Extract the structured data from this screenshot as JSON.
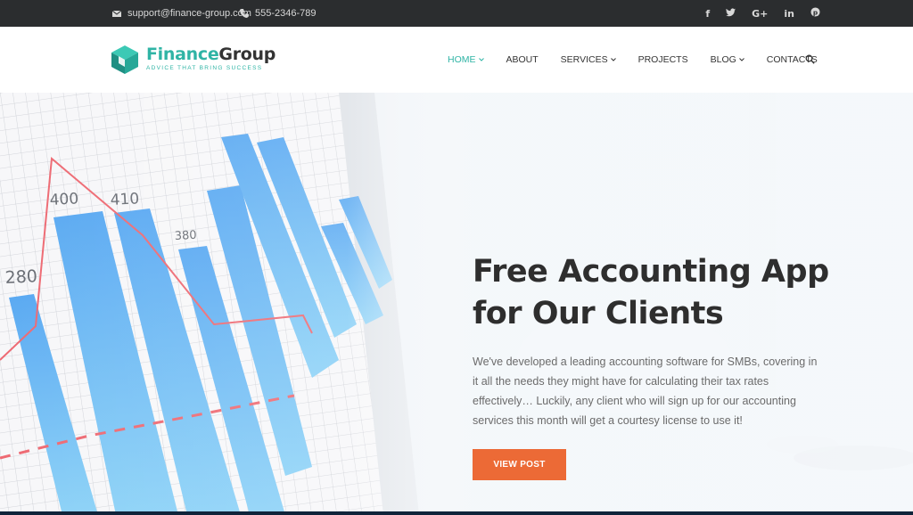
{
  "topbar": {
    "email": "support@finance-group.com",
    "phone": "555-2346-789",
    "social": [
      {
        "icon": "facebook-icon",
        "glyph": "f"
      },
      {
        "icon": "twitter-icon",
        "glyph": "🐦"
      },
      {
        "icon": "google-plus-icon",
        "glyph": "G+"
      },
      {
        "icon": "linkedin-icon",
        "glyph": "in"
      },
      {
        "icon": "pinterest-icon",
        "glyph": "℗"
      }
    ]
  },
  "logo": {
    "name_part1": "Finance",
    "name_part2": "Group",
    "tagline": "ADVICE THAT BRING SUCCESS"
  },
  "nav": {
    "items": [
      {
        "label": "HOME",
        "dropdown": true,
        "active": true
      },
      {
        "label": "ABOUT",
        "dropdown": false,
        "active": false
      },
      {
        "label": "SERVICES",
        "dropdown": true,
        "active": false
      },
      {
        "label": "PROJECTS",
        "dropdown": false,
        "active": false
      },
      {
        "label": "BLOG",
        "dropdown": true,
        "active": false
      },
      {
        "label": "CONTACTS",
        "dropdown": false,
        "active": false
      }
    ]
  },
  "hero": {
    "title_line1": "Free Accounting App",
    "title_line2": "for Our Clients",
    "text": "We've developed a leading accounting software for SMBs, covering in it all the needs they might have for calculating their tax rates effectively… Luckily, any client who will sign up for our accounting services this month will get a courtesy license to use it!",
    "button_label": "VIEW POST",
    "background_chart_labels": [
      "400",
      "410",
      "380",
      "280"
    ]
  },
  "colors": {
    "accent": "#2fb4a5",
    "button": "#ec6a36",
    "topbar": "#2b2d2f"
  }
}
